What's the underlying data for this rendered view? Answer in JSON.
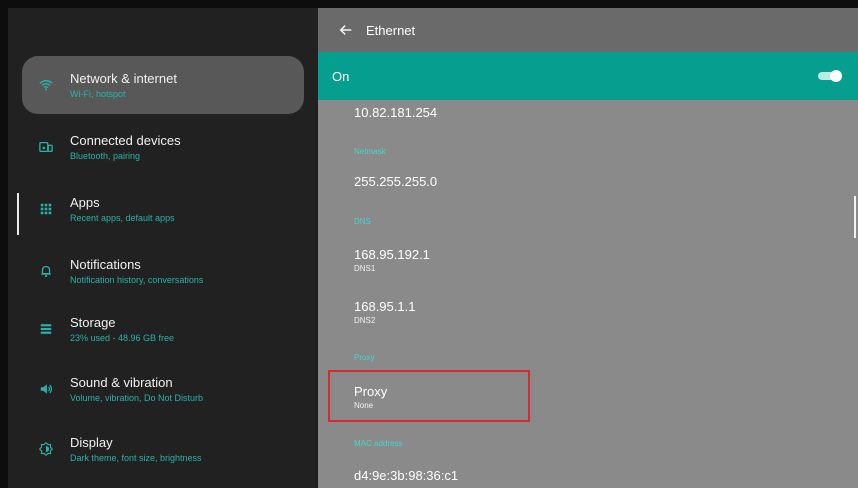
{
  "sidebar": {
    "items": [
      {
        "label": "Network & internet",
        "sub": "Wi-Fi, hotspot",
        "icon": "wifi-icon",
        "selected": true
      },
      {
        "label": "Connected devices",
        "sub": "Bluetooth, pairing",
        "icon": "devices-icon",
        "selected": false
      },
      {
        "label": "Apps",
        "sub": "Recent apps, default apps",
        "icon": "apps-grid-icon",
        "selected": false
      },
      {
        "label": "Notifications",
        "sub": "Notification history, conversations",
        "icon": "bell-icon",
        "selected": false
      },
      {
        "label": "Storage",
        "sub": "23% used - 48.96 GB free",
        "icon": "storage-icon",
        "selected": false
      },
      {
        "label": "Sound & vibration",
        "sub": "Volume, vibration, Do Not Disturb",
        "icon": "volume-icon",
        "selected": false
      },
      {
        "label": "Display",
        "sub": "Dark theme, font size, brightness",
        "icon": "display-icon",
        "selected": false
      }
    ]
  },
  "header": {
    "title": "Ethernet",
    "back_icon": "back-arrow-icon"
  },
  "ethernet": {
    "on_label": "On",
    "toggle_on": true,
    "ip_address": "10.82.181.254",
    "netmask_header": "Netmask",
    "netmask": "255.255.255.0",
    "dns_header": "DNS",
    "dns1_value": "168.95.192.1",
    "dns1_label": "DNS1",
    "dns2_value": "168.95.1.1",
    "dns2_label": "DNS2",
    "proxy_header": "Proxy",
    "proxy_title": "Proxy",
    "proxy_value": "None",
    "mac_header": "MAC address",
    "mac_value": "d4:9e:3b:98:36:c1"
  },
  "colors": {
    "accent": "#069f8f",
    "accent_text": "#29b3a6",
    "highlight": "#d22c2c"
  }
}
